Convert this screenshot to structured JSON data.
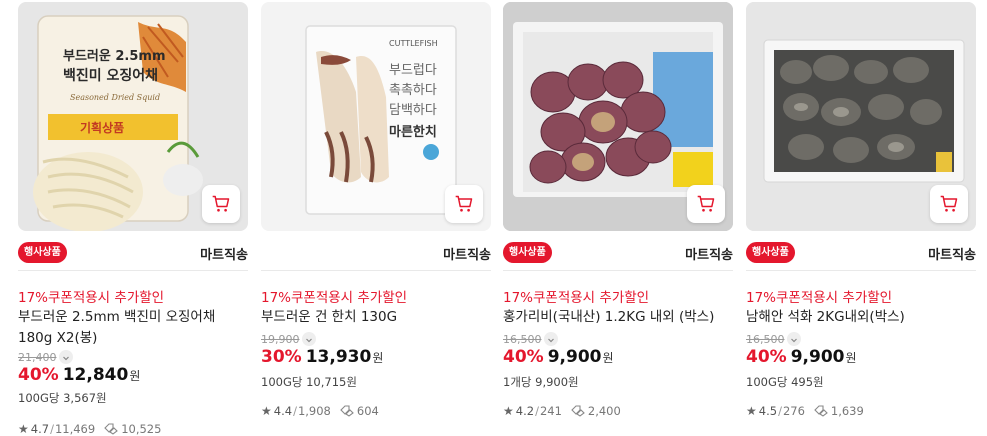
{
  "products": [
    {
      "badge": "행사상품",
      "shipping": "마트직송",
      "promo": "17%쿠폰적용시 추가할인",
      "name": "부드러운 2.5mm 백진미 오징어채 180g X2(봉)",
      "original_price": "21,400",
      "discount": "40%",
      "price": "12,840",
      "currency": "원",
      "unit_price": "100G당 3,567원",
      "rating": "4.7",
      "review_count": "11,469",
      "purchase_count": "10,525",
      "package_texts": [
        "부드러운 2.5mm",
        "백진미 오징어채",
        "Seasoned Dried Squid",
        "기획상품"
      ]
    },
    {
      "badge": "",
      "shipping": "마트직송",
      "promo": "17%쿠폰적용시 추가할인",
      "name": "부드러운 건 한치 130G",
      "original_price": "19,900",
      "discount": "30%",
      "price": "13,930",
      "currency": "원",
      "unit_price": "100G당 10,715원",
      "rating": "4.4",
      "review_count": "1,908",
      "purchase_count": "604",
      "package_texts": [
        "CUTTLEFISH",
        "부드럽다",
        "촉촉하다",
        "담백하다",
        "마른한치"
      ]
    },
    {
      "badge": "행사상품",
      "shipping": "마트직송",
      "promo": "17%쿠폰적용시 추가할인",
      "name": "홍가리비(국내산) 1.2KG 내외 (박스)",
      "original_price": "16,500",
      "discount": "40%",
      "price": "9,900",
      "currency": "원",
      "unit_price": "1개당 9,900원",
      "rating": "4.2",
      "review_count": "241",
      "purchase_count": "2,400"
    },
    {
      "badge": "행사상품",
      "shipping": "마트직송",
      "promo": "17%쿠폰적용시 추가할인",
      "name": "남해안 석화 2KG내외(박스)",
      "original_price": "16,500",
      "discount": "40%",
      "price": "9,900",
      "currency": "원",
      "unit_price": "100G당 495원",
      "rating": "4.5",
      "review_count": "276",
      "purchase_count": "1,639"
    }
  ],
  "icons": {
    "cart": "cart-icon",
    "star": "star-icon",
    "purchase": "purchase-tag-icon",
    "chevron": "chevron-down-icon"
  },
  "colors": {
    "accent": "#e4172d",
    "text": "#222222",
    "muted": "#999999"
  }
}
